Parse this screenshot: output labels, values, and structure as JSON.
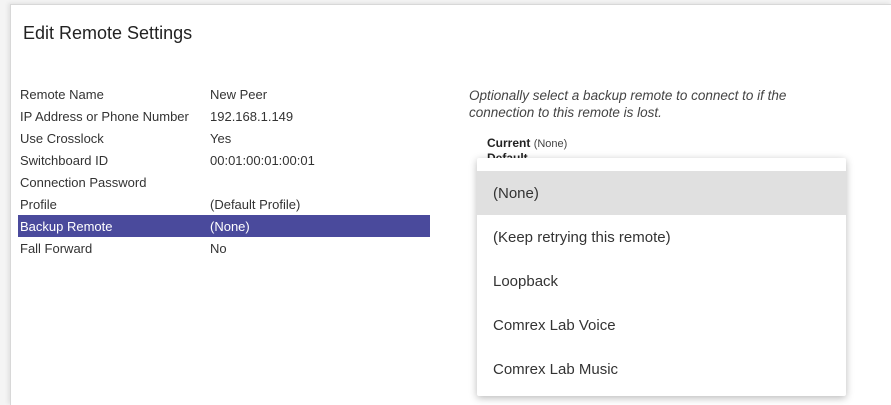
{
  "dialog": {
    "title": "Edit Remote Settings"
  },
  "settings": [
    {
      "key": "Remote Name",
      "value": "New Peer"
    },
    {
      "key": "IP Address or Phone Number",
      "value": "192.168.1.149"
    },
    {
      "key": "Use Crosslock",
      "value": "Yes"
    },
    {
      "key": "Switchboard ID",
      "value": "00:01:00:01:00:01"
    },
    {
      "key": "Connection Password",
      "value": ""
    },
    {
      "key": "Profile",
      "value": "(Default Profile)"
    },
    {
      "key": "Backup Remote",
      "value": "(None)",
      "selected": true
    },
    {
      "key": "Fall Forward",
      "value": "No"
    }
  ],
  "backup": {
    "help": "Optionally select a backup remote to connect to if the connection to this remote is lost.",
    "current_label": "Current",
    "current_value": "(None)",
    "default_label": "Default"
  },
  "dropdown": {
    "options": [
      "(None)",
      "(Keep retrying this remote)",
      "Loopback",
      "Comrex Lab Voice",
      "Comrex Lab Music"
    ],
    "highlighted": "(None)"
  },
  "colors": {
    "selected_row": "#4a4a9c",
    "highlighted_option": "#e0e0e0"
  }
}
